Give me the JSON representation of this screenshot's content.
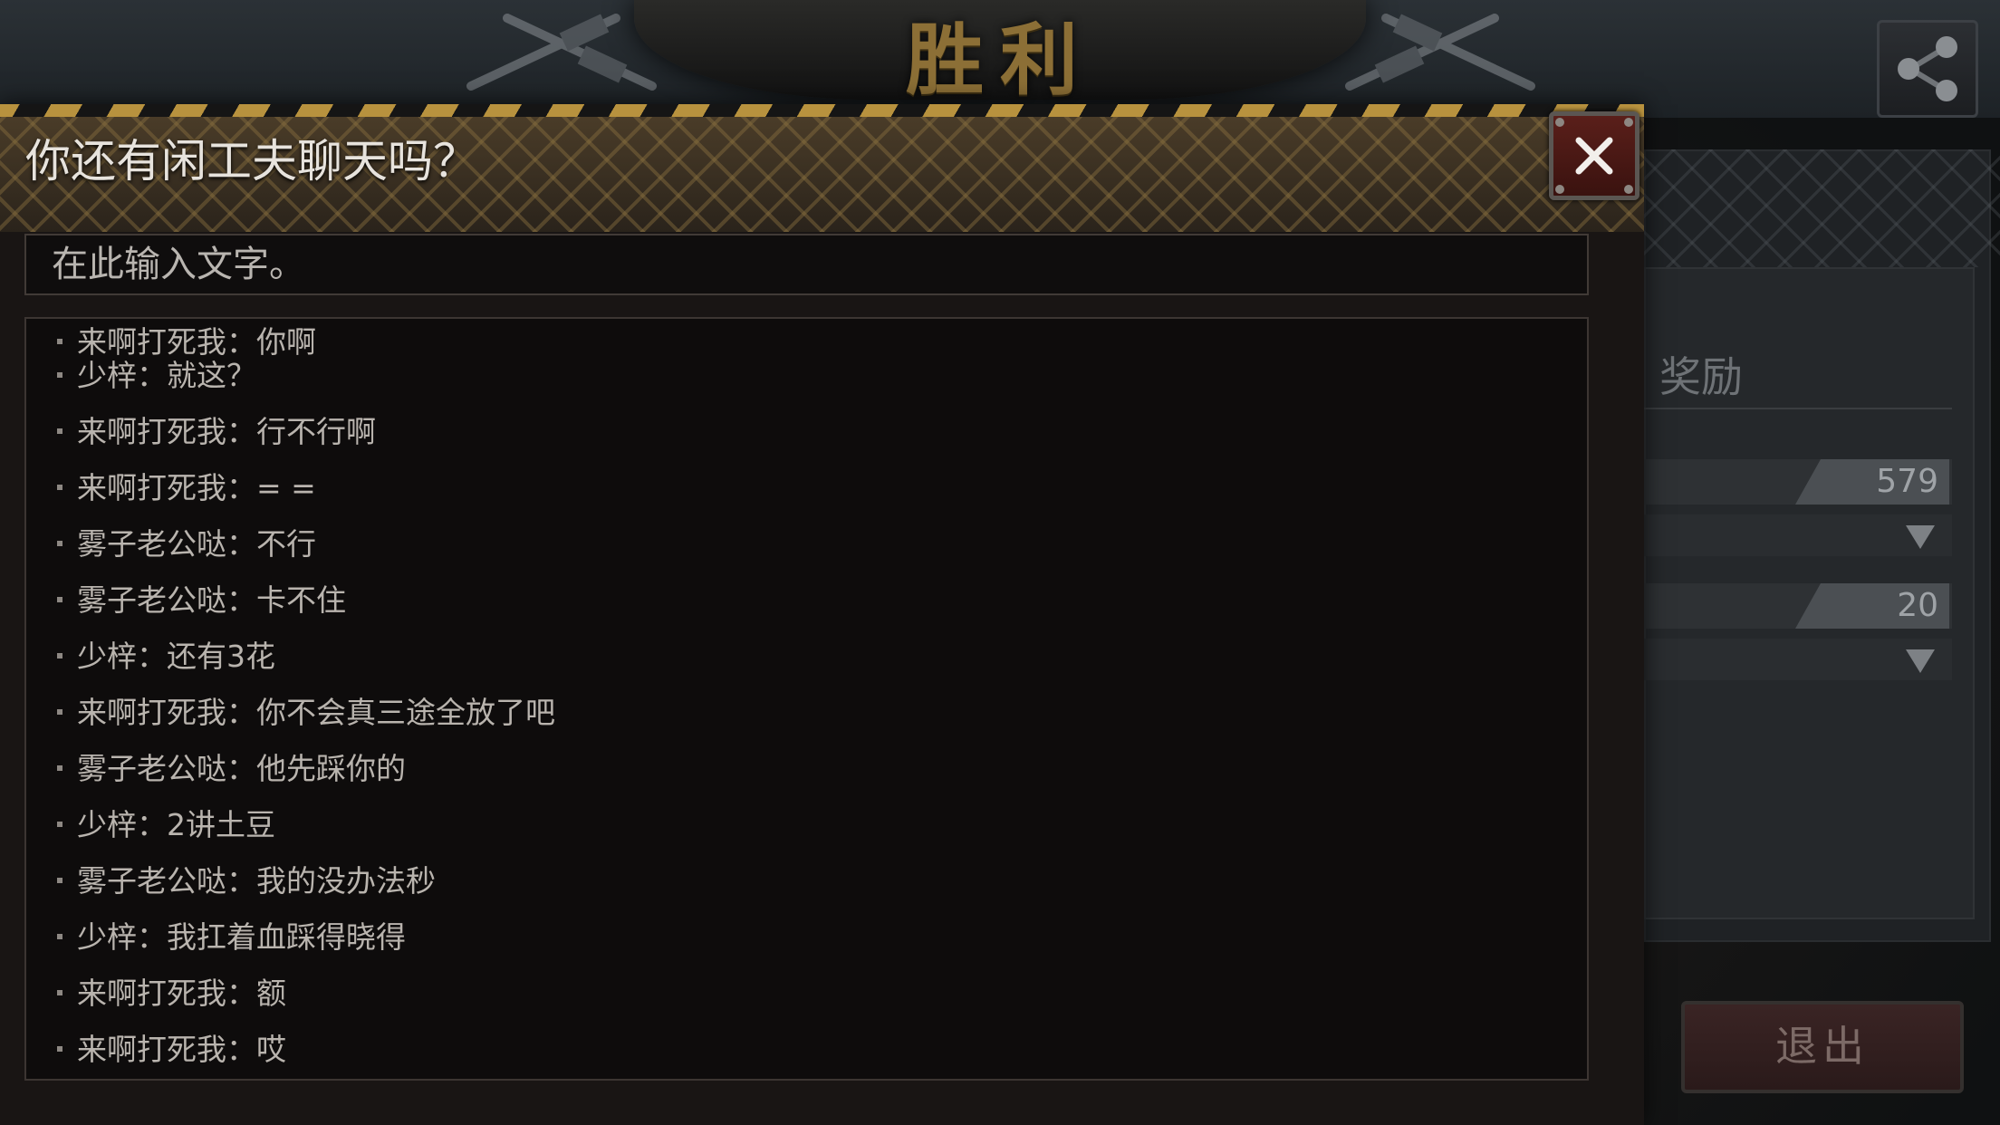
{
  "background": {
    "title": "胜利",
    "reward_title": "奖励",
    "reward_rows": [
      {
        "value": "579"
      },
      {
        "value": "20"
      }
    ],
    "exit_label": "退出"
  },
  "chat_dialog": {
    "title": "你还有闲工夫聊天吗？",
    "input_placeholder": "在此输入文字。",
    "messages": [
      {
        "text": "来啊打死我：你啊"
      },
      {
        "text": "少梓：就这？"
      },
      {
        "text": "来啊打死我：行不行啊"
      },
      {
        "text": "来啊打死我：= ="
      },
      {
        "text": "雾子老公哒：不行"
      },
      {
        "text": "雾子老公哒：卡不住"
      },
      {
        "text": "少梓：还有3花"
      },
      {
        "text": "来啊打死我：你不会真三途全放了吧"
      },
      {
        "text": "雾子老公哒：他先踩你的"
      },
      {
        "text": "少梓：2讲土豆"
      },
      {
        "text": "雾子老公哒：我的没办法秒"
      },
      {
        "text": "少梓：我扛着血踩得晓得"
      },
      {
        "text": "来啊打死我：额"
      },
      {
        "text": "来啊打死我：哎"
      }
    ]
  },
  "icons": {
    "share": "share-icon",
    "close": "close-icon",
    "dropdown": "chevron-down-icon"
  },
  "colors": {
    "accent_gold": "#b8923e",
    "title_gold": "#8c6f36",
    "close_red": "#5a1f1a"
  }
}
